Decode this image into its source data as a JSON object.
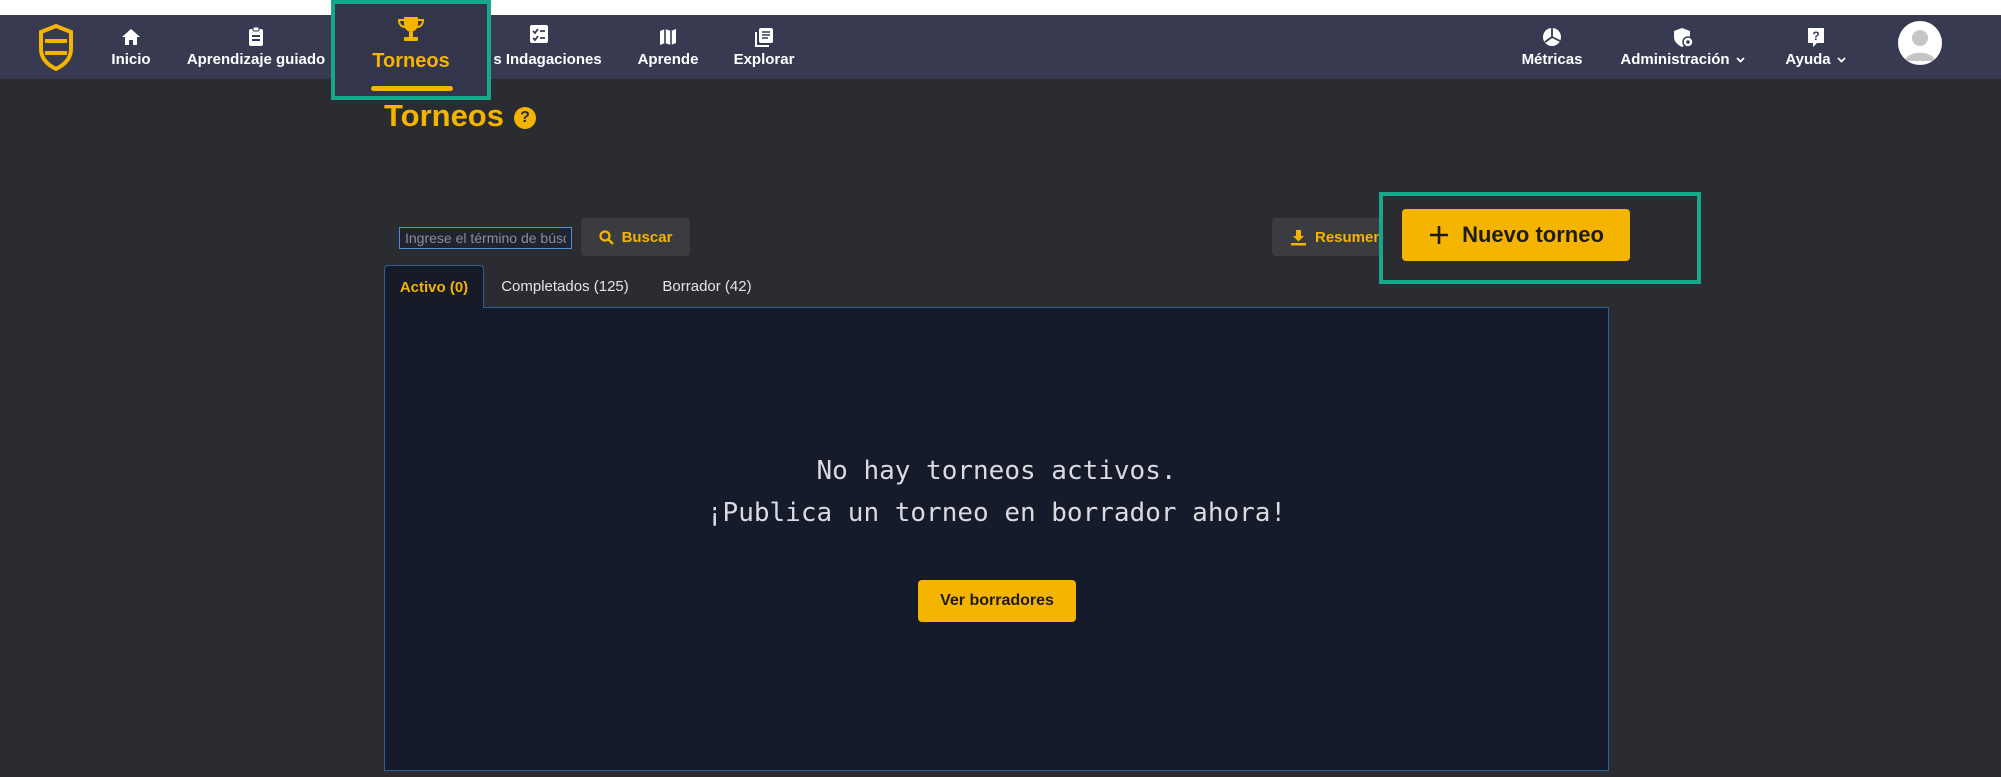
{
  "nav": {
    "items": [
      {
        "label": "Inicio",
        "icon": "home-icon"
      },
      {
        "label": "Aprendizaje guiado",
        "icon": "clipboard-icon"
      },
      {
        "label": "Torneos",
        "icon": "trophy-icon"
      },
      {
        "label": "s Indagaciones",
        "icon": "checklist-icon"
      },
      {
        "label": "Aprende",
        "icon": "map-icon"
      },
      {
        "label": "Explorar",
        "icon": "library-icon"
      }
    ],
    "right": [
      {
        "label": "Métricas",
        "icon": "pie-chart-icon"
      },
      {
        "label": "Administración",
        "icon": "shield-gear-icon"
      },
      {
        "label": "Ayuda",
        "icon": "question-icon"
      }
    ]
  },
  "page": {
    "title": "Torneos",
    "help_symbol": "?"
  },
  "search": {
    "placeholder": "Ingrese el término de búsqueda",
    "button_label": "Buscar"
  },
  "actions": {
    "resumen_label": "Resumen",
    "new_label": "Nuevo torneo"
  },
  "tabs": [
    {
      "label": "Activo (0)"
    },
    {
      "label": "Completados (125)"
    },
    {
      "label": "Borrador (42)"
    }
  ],
  "empty_state": {
    "line1": "No hay torneos activos.",
    "line2": "¡Publica un torneo en borrador ahora!",
    "button_label": "Ver borradores"
  },
  "colors": {
    "accent": "#f4b400",
    "nav_bg": "#383a52",
    "highlight": "#17a88b",
    "panel_bg": "#151b2a",
    "page_bg": "#2a2c31"
  }
}
